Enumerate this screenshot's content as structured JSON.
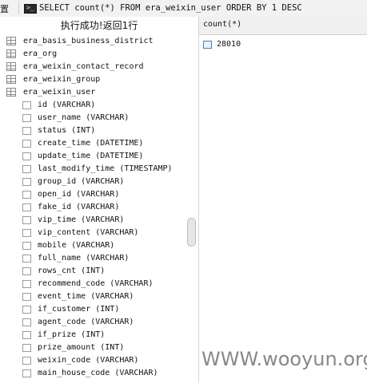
{
  "topbar": {
    "left_char": "置",
    "sql_text": "SELECT count(*) FROM era_weixin_user ORDER BY 1 DESC",
    "terminal_icon": "terminal-icon"
  },
  "status": {
    "message": "执行成功!返回1行"
  },
  "tree": {
    "tables": [
      {
        "name": "era_basis_business_district"
      },
      {
        "name": "era_org"
      },
      {
        "name": "era_weixin_contact_record"
      },
      {
        "name": "era_weixin_group"
      },
      {
        "name": "era_weixin_user"
      }
    ],
    "columns": [
      "id (VARCHAR)",
      "user_name (VARCHAR)",
      "status (INT)",
      "create_time (DATETIME)",
      "update_time (DATETIME)",
      "last_modify_time (TIMESTAMP)",
      "group_id (VARCHAR)",
      "open_id (VARCHAR)",
      "fake_id (VARCHAR)",
      "vip_time (VARCHAR)",
      "vip_content (VARCHAR)",
      "mobile (VARCHAR)",
      "full_name (VARCHAR)",
      "rows_cnt (INT)",
      "recommend_code (VARCHAR)",
      "event_time (VARCHAR)",
      "if_customer (INT)",
      "agent_code (VARCHAR)",
      "if_prize (INT)",
      "prize_amount (INT)",
      "weixin_code (VARCHAR)",
      "main_house_code (VARCHAR)"
    ]
  },
  "result": {
    "column_header": "count(*)",
    "rows": [
      "28010"
    ]
  },
  "watermark": "WWW.wooyun.org"
}
